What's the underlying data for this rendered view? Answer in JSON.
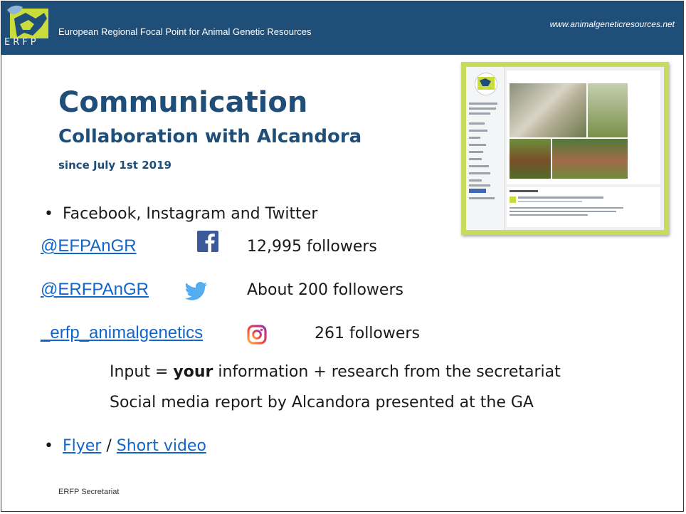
{
  "header": {
    "logo_text": "ERFP",
    "title": "European Regional Focal Point for Animal Genetic Resources",
    "url": "www.animalgeneticresources.net"
  },
  "slide": {
    "title": "Communication",
    "subtitle": "Collaboration with Alcandora",
    "since": "since July 1st 2019"
  },
  "bullets": {
    "platforms": "Facebook, Instagram and Twitter",
    "links_separator": "/"
  },
  "accounts": [
    {
      "handle": "@EFPAnGR",
      "icon": "facebook-icon",
      "followers": "12,995 followers"
    },
    {
      "handle": "@ERFPAnGR",
      "icon": "twitter-icon",
      "followers": "About 200 followers"
    },
    {
      "handle": "_erfp_animalgenetics",
      "icon": "instagram-icon",
      "followers": "261 followers"
    }
  ],
  "notes": {
    "input_prefix": "Input = ",
    "input_bold": "your",
    "input_suffix": " information + research from the secretariat",
    "report": "Social media report by Alcandora presented at the GA"
  },
  "links": {
    "flyer": "Flyer",
    "video": "Short video"
  },
  "footer": "ERFP Secretariat",
  "colors": {
    "header_bg": "#1f4e79",
    "title": "#1f4e79",
    "link": "#1366c7",
    "thumbnail_border": "#c7dc5c"
  }
}
